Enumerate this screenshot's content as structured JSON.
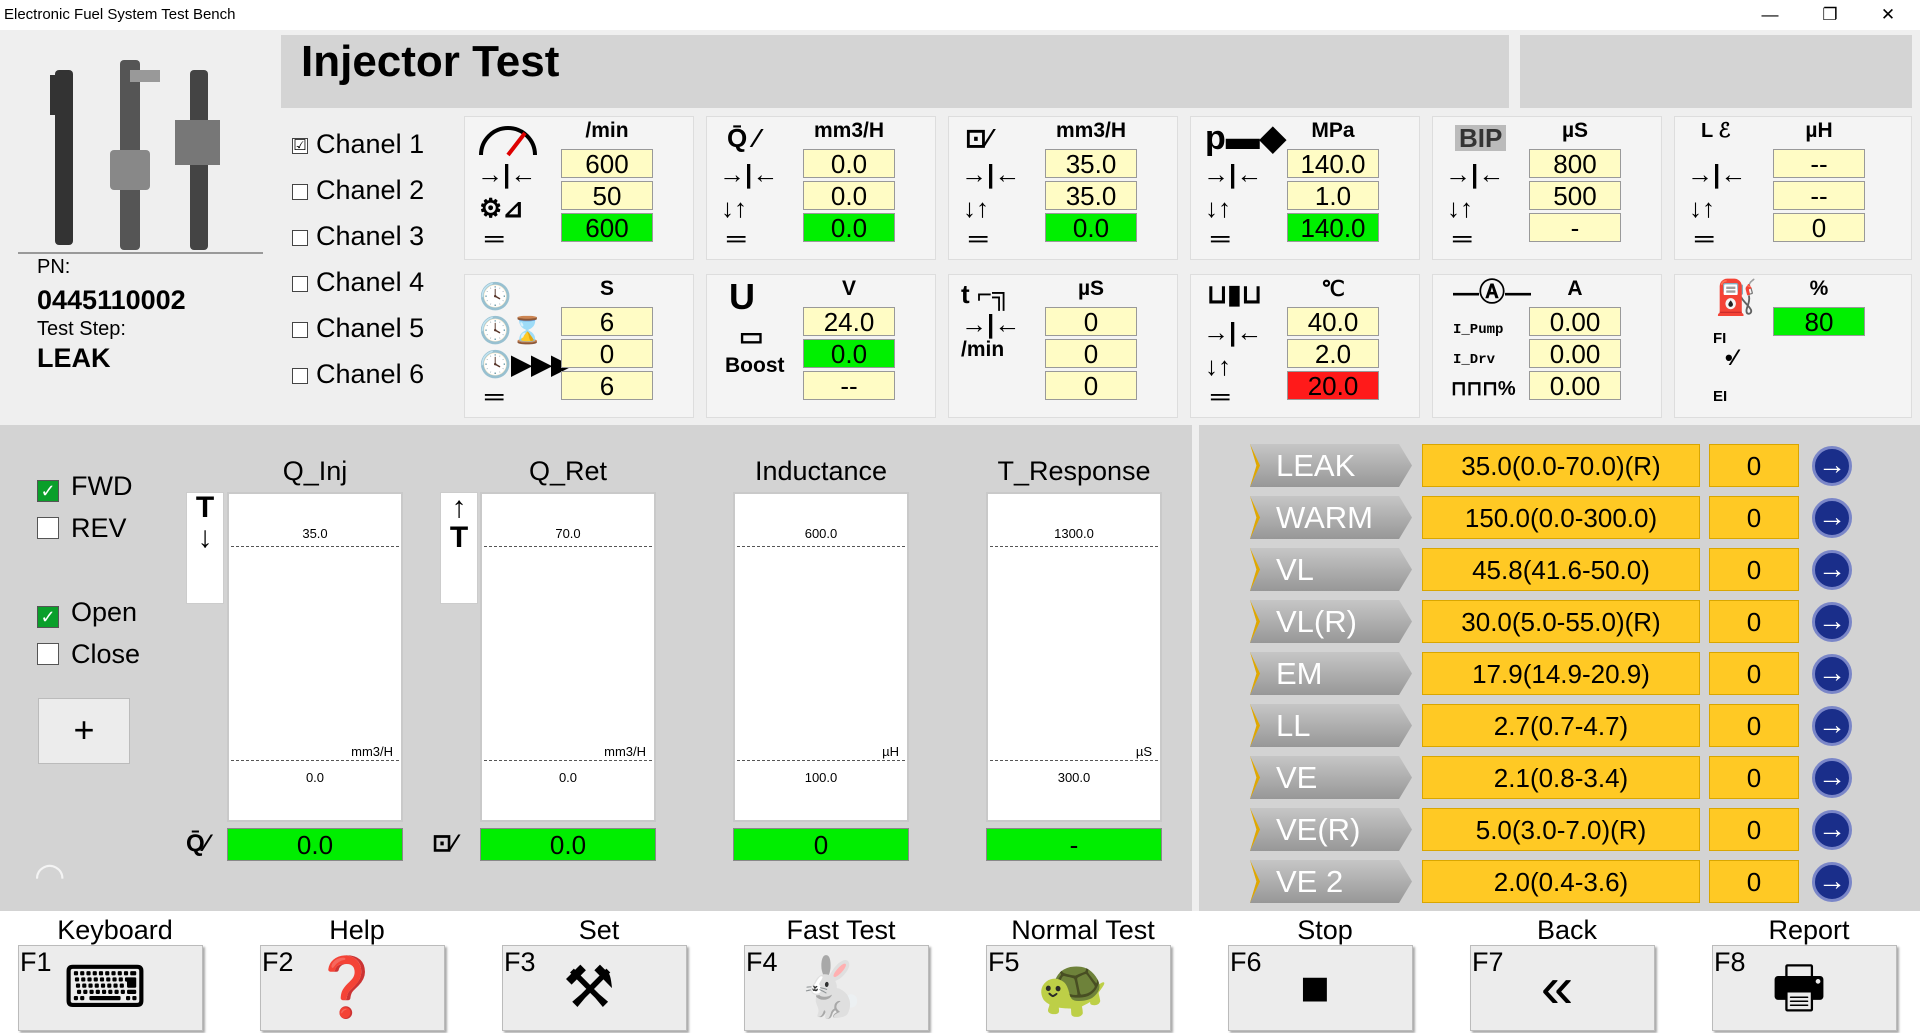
{
  "window": {
    "title": "Electronic Fuel System Test Bench",
    "controls": [
      "—",
      "❐",
      "✕"
    ]
  },
  "header": {
    "title": "Injector Test"
  },
  "info": {
    "pn_label": "PN:",
    "pn_value": "0445110002",
    "step_label": "Test Step:",
    "step_value": "LEAK"
  },
  "channels": [
    "Chanel 1",
    "Chanel 2",
    "Chanel 3",
    "Chanel 4",
    "Chanel 5",
    "Chanel 6"
  ],
  "channels_checked": [
    true,
    false,
    false,
    false,
    false,
    false
  ],
  "panels": {
    "speed": {
      "unit": "/min",
      "values": [
        "600",
        "50",
        "600"
      ]
    },
    "timing": {
      "unit": "S",
      "values": [
        "6",
        "0",
        "6"
      ]
    },
    "q_inj": {
      "unit": "mm3/H",
      "values": [
        "0.0",
        "0.0",
        "0.0"
      ]
    },
    "voltage": {
      "unit": "V",
      "label": "Boost",
      "values": [
        "24.0",
        "0.0",
        "--"
      ]
    },
    "q_ret": {
      "unit": "mm3/H",
      "values": [
        "35.0",
        "35.0",
        "0.0"
      ]
    },
    "pulse": {
      "unit": "µS",
      "label": "/min",
      "values": [
        "0",
        "0",
        "0"
      ]
    },
    "pressure": {
      "unit": "MPa",
      "values": [
        "140.0",
        "1.0",
        "140.0"
      ]
    },
    "temp": {
      "unit": "℃",
      "values": [
        "40.0",
        "2.0",
        "20.0"
      ]
    },
    "bip": {
      "unit": "µS",
      "label": "BIP",
      "values": [
        "800",
        "500",
        "-"
      ]
    },
    "current": {
      "unit": "A",
      "labels": [
        "I_Pump",
        "I_Drv",
        "%"
      ],
      "values": [
        "0.00",
        "0.00",
        "0.00"
      ]
    },
    "induct": {
      "unit": "µH",
      "values": [
        "--",
        "--",
        "0"
      ]
    },
    "fuel": {
      "unit": "%",
      "labels": [
        "FI",
        "EI"
      ],
      "values": [
        "80"
      ]
    }
  },
  "controls": {
    "fwd": "FWD",
    "rev": "REV",
    "open": "Open",
    "close": "Close",
    "plus": "+"
  },
  "gauges": [
    {
      "title": "Q_Inj",
      "top": "35.0",
      "bottom": "0.0",
      "unit": "mm3/H",
      "result": "0.0"
    },
    {
      "title": "Q_Ret",
      "top": "70.0",
      "bottom": "0.0",
      "unit": "mm3/H",
      "result": "0.0"
    },
    {
      "title": "Inductance",
      "top": "600.0",
      "bottom": "100.0",
      "unit": "µH",
      "result": "0"
    },
    {
      "title": "T_Response",
      "top": "1300.0",
      "bottom": "300.0",
      "unit": "µS",
      "result": "-"
    }
  ],
  "steps": [
    {
      "name": "LEAK",
      "range": "35.0(0.0-70.0)(R)",
      "count": "0"
    },
    {
      "name": "WARM",
      "range": "150.0(0.0-300.0)",
      "count": "0"
    },
    {
      "name": "VL",
      "range": "45.8(41.6-50.0)",
      "count": "0"
    },
    {
      "name": "VL(R)",
      "range": "30.0(5.0-55.0)(R)",
      "count": "0"
    },
    {
      "name": "EM",
      "range": "17.9(14.9-20.9)",
      "count": "0"
    },
    {
      "name": "LL",
      "range": "2.7(0.7-4.7)",
      "count": "0"
    },
    {
      "name": "VE",
      "range": "2.1(0.8-3.4)",
      "count": "0"
    },
    {
      "name": "VE(R)",
      "range": "5.0(3.0-7.0)(R)",
      "count": "0"
    },
    {
      "name": "VE 2",
      "range": "2.0(0.4-3.6)",
      "count": "0"
    }
  ],
  "fkeys": [
    {
      "key": "F1",
      "label": "Keyboard",
      "icon": "keyboard-icon"
    },
    {
      "key": "F2",
      "label": "Help",
      "icon": "help-icon"
    },
    {
      "key": "F3",
      "label": "Set",
      "icon": "tools-icon"
    },
    {
      "key": "F4",
      "label": "Fast Test",
      "icon": "rabbit-icon"
    },
    {
      "key": "F5",
      "label": "Normal Test",
      "icon": "turtle-icon"
    },
    {
      "key": "F6",
      "label": "Stop",
      "icon": "stop-icon"
    },
    {
      "key": "F7",
      "label": "Back",
      "icon": "back-icon"
    },
    {
      "key": "F8",
      "label": "Report",
      "icon": "printer-icon"
    }
  ]
}
